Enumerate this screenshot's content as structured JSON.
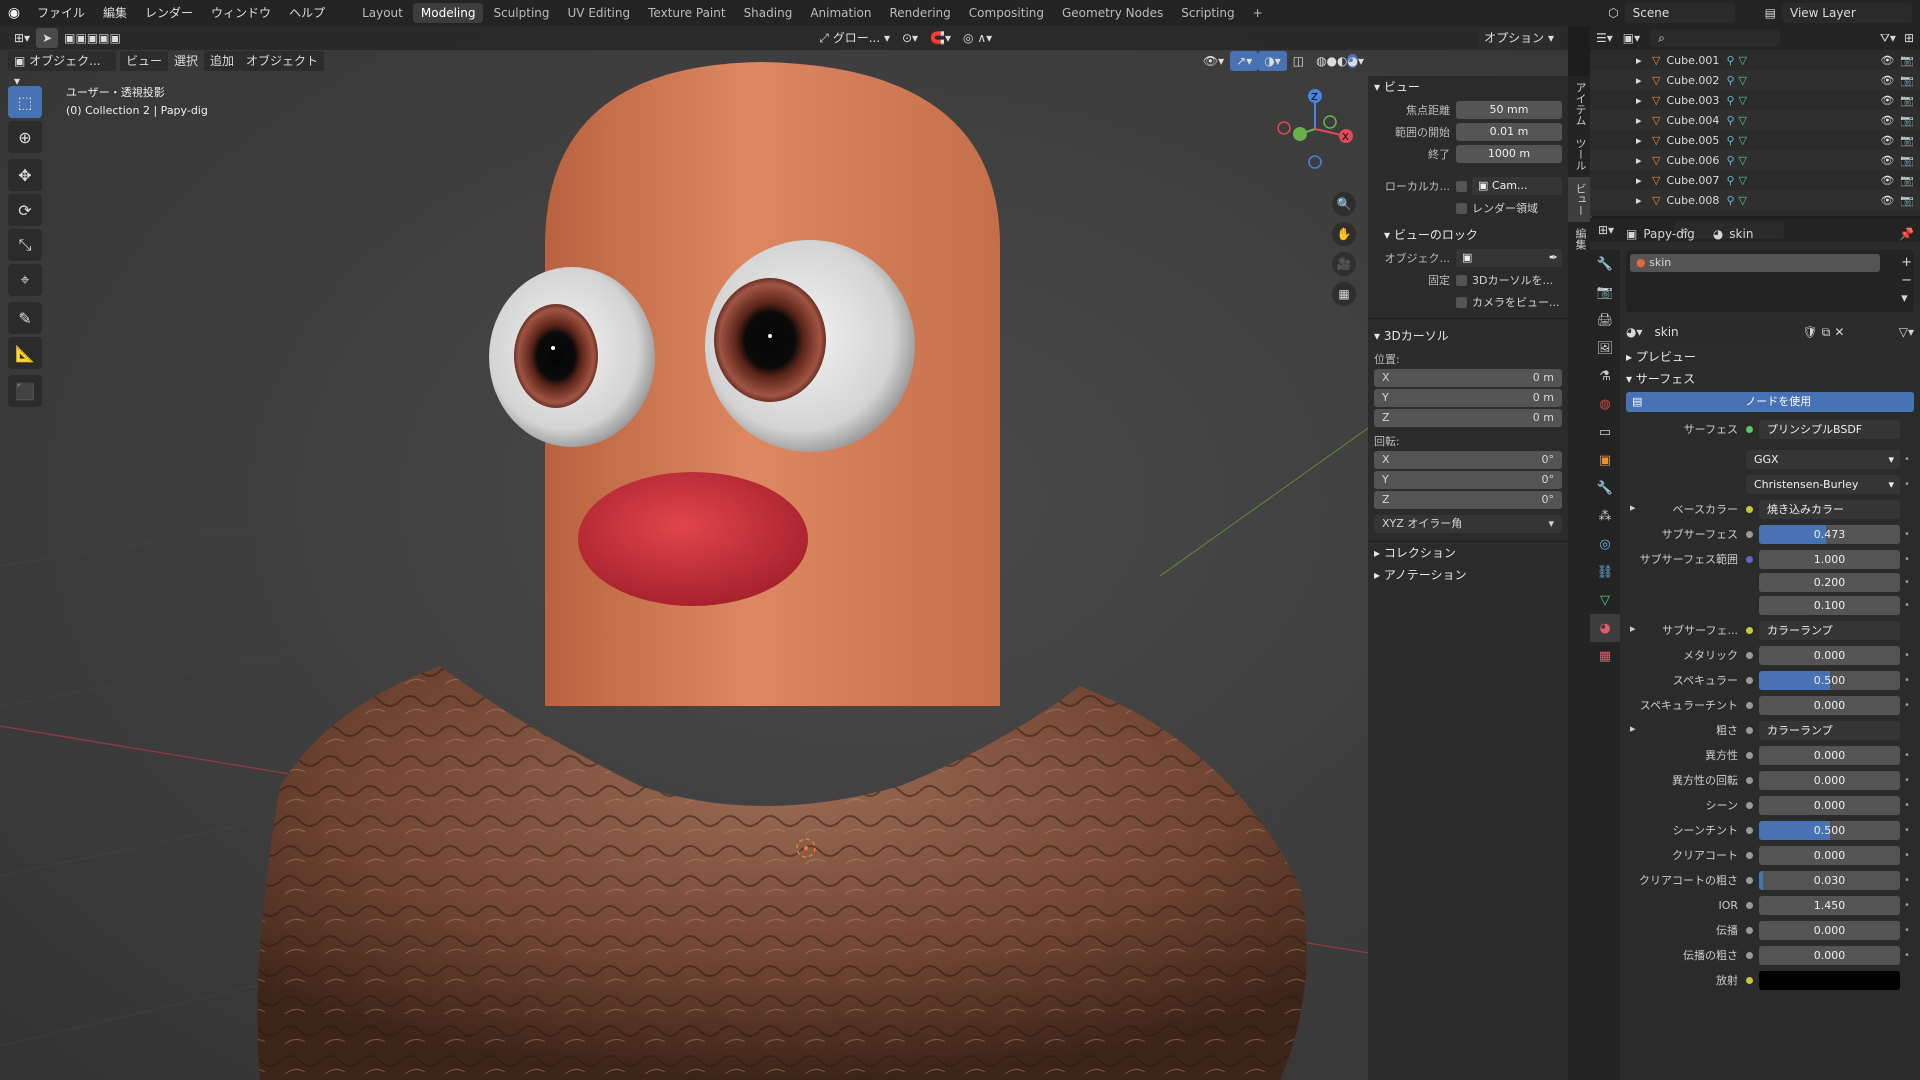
{
  "topbar": {
    "menus": [
      "ファイル",
      "編集",
      "レンダー",
      "ウィンドウ",
      "ヘルプ"
    ],
    "workspaces": [
      "Layout",
      "Modeling",
      "Sculpting",
      "UV Editing",
      "Texture Paint",
      "Shading",
      "Animation",
      "Rendering",
      "Compositing",
      "Geometry Nodes",
      "Scripting"
    ],
    "active_workspace": "Modeling",
    "scene": "Scene",
    "view_layer": "View Layer"
  },
  "viewport": {
    "mode": "オブジェク...",
    "menus": [
      "ビュー",
      "選択",
      "追加",
      "オブジェクト"
    ],
    "orientation": "グロー...",
    "options": "オプション",
    "overlay_title": "ユーザー・透視投影",
    "overlay_sub": "(0) Collection 2 | Papy-dig"
  },
  "npanel": {
    "view_title": "ビュー",
    "focal_label": "焦点距離",
    "focal": "50 mm",
    "clip_start_label": "範囲の開始",
    "clip_start": "0.01 m",
    "clip_end_label": "終了",
    "clip_end": "1000 m",
    "local_cam_label": "ローカルカ...",
    "local_cam_val": "Cam...",
    "render_region": "レンダー領域",
    "view_lock": "ビューのロック",
    "lock_object_label": "オブジェク...",
    "lock_label": "固定",
    "lock_cursor": "3Dカーソルを...",
    "lock_camera": "カメラをビュー...",
    "cursor_title": "3Dカーソル",
    "location_label": "位置:",
    "loc": [
      {
        "a": "X",
        "v": "0 m"
      },
      {
        "a": "Y",
        "v": "0 m"
      },
      {
        "a": "Z",
        "v": "0 m"
      }
    ],
    "rotation_label": "回転:",
    "rot": [
      {
        "a": "X",
        "v": "0°"
      },
      {
        "a": "Y",
        "v": "0°"
      },
      {
        "a": "Z",
        "v": "0°"
      }
    ],
    "rot_mode": "XYZ オイラー角",
    "collection": "コレクション",
    "annotation": "アノテーション",
    "tabs": [
      "アイテム",
      "ツール",
      "ビュー",
      "編集"
    ]
  },
  "outliner": {
    "items": [
      "Cube.001",
      "Cube.002",
      "Cube.003",
      "Cube.004",
      "Cube.005",
      "Cube.006",
      "Cube.007",
      "Cube.008"
    ]
  },
  "properties": {
    "object": "Papy-dig",
    "material_name": "skin",
    "slot": "skin",
    "preview": "プレビュー",
    "surface_section": "サーフェス",
    "use_nodes": "ノードを使用",
    "surface_label": "サーフェス",
    "surface_shader": "プリンシプルBSDF",
    "distribution": "GGX",
    "subsurface_method": "Christensen-Burley",
    "base_color_label": "ベースカラー",
    "base_color_val": "焼き込みカラー",
    "subsurface_label": "サブサーフェス",
    "subsurface": "0.473",
    "subsurface_radius_label": "サブサーフェス範囲",
    "radius": [
      "1.000",
      "0.200",
      "0.100"
    ],
    "subsurface_color_label": "サブサーフェ...",
    "subsurface_color_val": "カラーランプ",
    "metallic_label": "メタリック",
    "metallic": "0.000",
    "specular_label": "スペキュラー",
    "specular": "0.500",
    "specular_tint_label": "スペキュラーチント",
    "specular_tint": "0.000",
    "roughness_label": "粗さ",
    "roughness_val": "カラーランプ",
    "anisotropic_label": "異方性",
    "anisotropic": "0.000",
    "anisotropic_rot_label": "異方性の回転",
    "anisotropic_rot": "0.000",
    "sheen_label": "シーン",
    "sheen": "0.000",
    "sheen_tint_label": "シーンチント",
    "sheen_tint": "0.500",
    "clearcoat_label": "クリアコート",
    "clearcoat": "0.000",
    "clearcoat_rough_label": "クリアコートの粗さ",
    "clearcoat_rough": "0.030",
    "ior_label": "IOR",
    "ior": "1.450",
    "transmission_label": "伝播",
    "transmission": "0.000",
    "transmission_rough_label": "伝播の粗さ",
    "transmission_rough": "0.000",
    "emission_label": "放射"
  },
  "colors": {
    "accent": "#4772b3",
    "skin": "#d57f5a",
    "lips": "#c8323c",
    "rock": "#7a4e3a"
  }
}
